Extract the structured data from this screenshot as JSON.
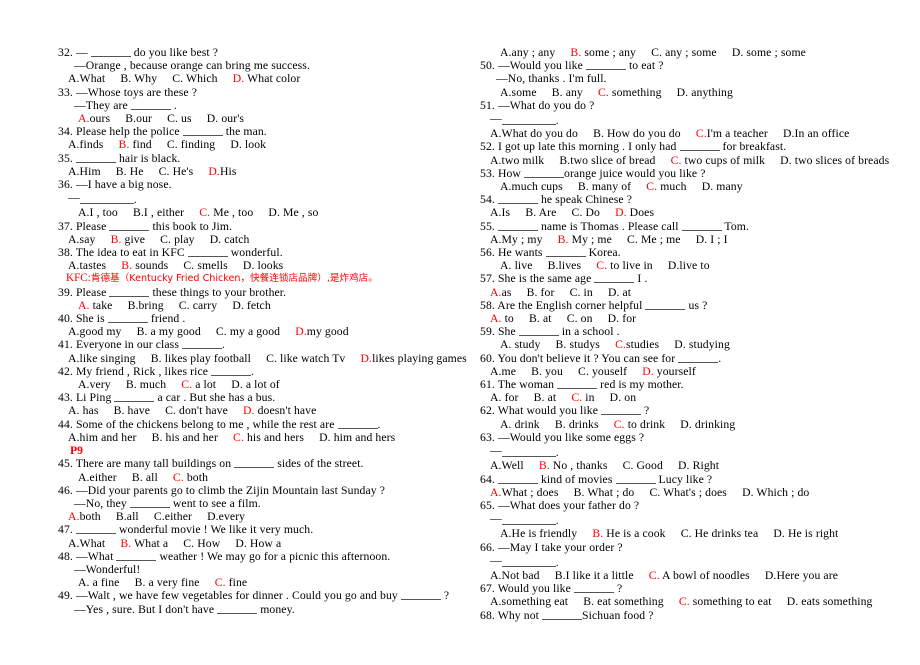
{
  "document": {
    "type": "english-grammar-multiple-choice-worksheet",
    "answer_color": "#FF0000",
    "text_color": "#000000",
    "background_color": "#FFFFFF"
  },
  "annotations": {
    "kfc_note": "KFC:肯德基（Kentucky Fried Chicken，快餐连锁店品牌）,是炸鸡店。",
    "page_marker": "P9"
  },
  "left_column": [
    {
      "number": "32.",
      "stem": "— ______ do you like best ?",
      "reply": "—Orange , because orange can bring me success.",
      "options": [
        {
          "text": "A.What",
          "correct": false
        },
        {
          "text": "B. Why",
          "correct": false
        },
        {
          "text": "C. Which",
          "correct": false
        },
        {
          "text": "D. What color",
          "correct": true
        }
      ]
    },
    {
      "number": "33.",
      "stem": "—Whose toys are these ?",
      "reply": "—They are ______ .",
      "options": [
        {
          "text": "A.ours",
          "correct": true
        },
        {
          "text": "B.our",
          "correct": false
        },
        {
          "text": "C. us",
          "correct": false
        },
        {
          "text": "D. our's",
          "correct": false
        }
      ]
    },
    {
      "number": "34.",
      "stem": "Please help the police ______ the man.",
      "options": [
        {
          "text": "A.finds",
          "correct": false
        },
        {
          "text": "B. find",
          "correct": true
        },
        {
          "text": "C. finding",
          "correct": false
        },
        {
          "text": "D. look",
          "correct": false
        }
      ]
    },
    {
      "number": "35.",
      "stem": "______ hair is black.",
      "options": [
        {
          "text": "A.Him",
          "correct": false
        },
        {
          "text": "B. He",
          "correct": false
        },
        {
          "text": "C. He's",
          "correct": false
        },
        {
          "text": "D.His",
          "correct": true
        }
      ]
    },
    {
      "number": "36.",
      "stem": "—I have a big nose.",
      "answer_blank": true,
      "options": [
        {
          "text": "A.I , too",
          "correct": false
        },
        {
          "text": "B.I , either",
          "correct": false
        },
        {
          "text": "C. Me , too",
          "correct": true
        },
        {
          "text": "D. Me , so",
          "correct": false
        }
      ]
    },
    {
      "number": "37.",
      "stem": "Please ______ this book to Jim.",
      "options": [
        {
          "text": "A.say",
          "correct": false
        },
        {
          "text": "B. give",
          "correct": true
        },
        {
          "text": "C. play",
          "correct": false
        },
        {
          "text": "D. catch",
          "correct": false
        }
      ]
    },
    {
      "number": "38.",
      "stem": "The idea to eat in KFC ______ wonderful.",
      "options": [
        {
          "text": "A.tastes",
          "correct": false
        },
        {
          "text": "B. sounds",
          "correct": true
        },
        {
          "text": "C. smells",
          "correct": false
        },
        {
          "text": "D. looks",
          "correct": false
        }
      ],
      "note": "kfc"
    },
    {
      "number": "39.",
      "stem": "Please ______ these things to your brother.",
      "options": [
        {
          "text": "A. take",
          "correct": true
        },
        {
          "text": "B.bring",
          "correct": false
        },
        {
          "text": "C. carry",
          "correct": false
        },
        {
          "text": "D. fetch",
          "correct": false
        }
      ]
    },
    {
      "number": "40.",
      "stem": "She is ______ friend .",
      "options": [
        {
          "text": "A.good my",
          "correct": false
        },
        {
          "text": "B. a my good",
          "correct": false
        },
        {
          "text": "C. my a good",
          "correct": false
        },
        {
          "text": "D.my good",
          "correct": true
        }
      ]
    },
    {
      "number": "41.",
      "stem": "Everyone in our class ______.",
      "options": [
        {
          "text": "A.like singing",
          "correct": false
        },
        {
          "text": "B. likes play football",
          "correct": false
        },
        {
          "text": "C. like watch Tv",
          "correct": false
        },
        {
          "text": "D.likes playing games",
          "correct": true
        }
      ]
    },
    {
      "number": "42.",
      "stem": "My friend , Rick , likes rice ______.",
      "options": [
        {
          "text": "A.very",
          "correct": false
        },
        {
          "text": "B. much",
          "correct": false
        },
        {
          "text": "C. a lot",
          "correct": true
        },
        {
          "text": "D. a lot of",
          "correct": false
        }
      ]
    },
    {
      "number": "43.",
      "stem": "Li Ping ______ a car . But she has a bus.",
      "options": [
        {
          "text": "A. has",
          "correct": false
        },
        {
          "text": "B. have",
          "correct": false
        },
        {
          "text": "C. don't have",
          "correct": false
        },
        {
          "text": "D. doesn't have",
          "correct": true
        }
      ]
    },
    {
      "number": "44.",
      "stem": "Some of the chickens belong to me , while the rest are ______.",
      "options": [
        {
          "text": "A.him and her",
          "correct": false
        },
        {
          "text": "B. his and her",
          "correct": false
        },
        {
          "text": "C. his and hers",
          "correct": true
        },
        {
          "text": "D. him and hers",
          "correct": false
        }
      ],
      "note": "p9"
    },
    {
      "number": "45.",
      "stem": "There are many tall buildings on ______ sides of the street.",
      "options": [
        {
          "text": "A.either",
          "correct": false
        },
        {
          "text": "B. all",
          "correct": false
        },
        {
          "text": "C. both",
          "correct": true
        }
      ]
    },
    {
      "number": "46.",
      "stem": "—Did your parents go to climb the Zijin Mountain last Sunday ?",
      "reply": "—No, they ______ went to see a film.",
      "options": [
        {
          "text": "A.both",
          "correct": true
        },
        {
          "text": "B.all",
          "correct": false
        },
        {
          "text": "C.either",
          "correct": false
        },
        {
          "text": "D.every",
          "correct": false
        }
      ]
    },
    {
      "number": "47.",
      "stem": "______ wonderful movie ! We like it very much.",
      "options": [
        {
          "text": "A.What",
          "correct": false
        },
        {
          "text": "B. What a",
          "correct": true
        },
        {
          "text": "C. How",
          "correct": false
        },
        {
          "text": "D. How a",
          "correct": false
        }
      ]
    },
    {
      "number": "48.",
      "stem": "—What ______ weather ! We may go for a picnic this afternoon.",
      "reply": "—Wonderful!",
      "options": [
        {
          "text": "A. a fine",
          "correct": false
        },
        {
          "text": "B. a very fine",
          "correct": false
        },
        {
          "text": "C. fine",
          "correct": true
        }
      ]
    },
    {
      "number": "49.",
      "stem": "—Walt , we have few vegetables for dinner . Could you go and buy ______ ?",
      "reply": "—Yes , sure. But I don't have ______ money."
    }
  ],
  "right_column": [
    {
      "number": "",
      "options_only": true,
      "options": [
        {
          "text": "A.any ; any",
          "correct": false
        },
        {
          "text": "B. some ; any",
          "correct": true
        },
        {
          "text": "C. any ; some",
          "correct": false
        },
        {
          "text": "D. some ; some",
          "correct": false
        }
      ]
    },
    {
      "number": "50.",
      "stem": "—Would you like ______ to eat ?",
      "reply": "—No, thanks . I'm full.",
      "options": [
        {
          "text": "A.some",
          "correct": false
        },
        {
          "text": "B. any",
          "correct": false
        },
        {
          "text": "C. something",
          "correct": true
        },
        {
          "text": "D. anything",
          "correct": false
        }
      ]
    },
    {
      "number": "51.",
      "stem": "—What do you do ?",
      "answer_blank": true,
      "options": [
        {
          "text": "A.What do you do",
          "correct": false
        },
        {
          "text": "B. How do you do",
          "correct": false
        },
        {
          "text": "C.I'm a teacher",
          "correct": true
        },
        {
          "text": "D.In an office",
          "correct": false
        }
      ]
    },
    {
      "number": "52.",
      "stem": "I got up late this morning . I only had ______ for breakfast.",
      "options": [
        {
          "text": "A.two milk",
          "correct": false
        },
        {
          "text": "B.two slice of bread",
          "correct": false
        },
        {
          "text": "C. two cups of milk",
          "correct": true
        },
        {
          "text": "D. two slices of breads",
          "correct": false
        }
      ]
    },
    {
      "number": "53.",
      "stem": "How ______orange juice would you like ?",
      "options": [
        {
          "text": "A.much cups",
          "correct": false
        },
        {
          "text": "B. many of",
          "correct": false
        },
        {
          "text": "C. much",
          "correct": true
        },
        {
          "text": "D. many",
          "correct": false
        }
      ]
    },
    {
      "number": "54.",
      "stem": "______ he speak Chinese ?",
      "options": [
        {
          "text": "A.Is",
          "correct": false
        },
        {
          "text": "B. Are",
          "correct": false
        },
        {
          "text": "C. Do",
          "correct": false
        },
        {
          "text": "D. Does",
          "correct": true
        }
      ]
    },
    {
      "number": "55.",
      "stem": "______ name is Thomas . Please call ______ Tom.",
      "options": [
        {
          "text": "A.My ; my",
          "correct": false
        },
        {
          "text": "B. My ; me",
          "correct": true
        },
        {
          "text": "C. Me ; me",
          "correct": false
        },
        {
          "text": "D. I ; I",
          "correct": false
        }
      ]
    },
    {
      "number": "56.",
      "stem": "He wants ______ Korea.",
      "options": [
        {
          "text": "A. live",
          "correct": false
        },
        {
          "text": "B.lives",
          "correct": false
        },
        {
          "text": "C. to live in",
          "correct": true
        },
        {
          "text": "D.live to",
          "correct": false
        }
      ]
    },
    {
      "number": "57.",
      "stem": "She is the same age ______ I .",
      "options": [
        {
          "text": "A.as",
          "correct": true
        },
        {
          "text": "B. for",
          "correct": false
        },
        {
          "text": "C. in",
          "correct": false
        },
        {
          "text": "D. at",
          "correct": false
        }
      ]
    },
    {
      "number": "58.",
      "stem": "Are the English corner helpful ______ us ?",
      "options": [
        {
          "text": "A. to",
          "correct": true
        },
        {
          "text": "B. at",
          "correct": false
        },
        {
          "text": "C. on",
          "correct": false
        },
        {
          "text": "D. for",
          "correct": false
        }
      ]
    },
    {
      "number": "59.",
      "stem": "She ______ in a school .",
      "options": [
        {
          "text": "A. study",
          "correct": false
        },
        {
          "text": "B. studys",
          "correct": false
        },
        {
          "text": "C.studies",
          "correct": true
        },
        {
          "text": "D. studying",
          "correct": false
        }
      ]
    },
    {
      "number": "60.",
      "stem": "You don't believe it ? You can see for ______.",
      "options": [
        {
          "text": "A.me",
          "correct": false
        },
        {
          "text": "B. you",
          "correct": false
        },
        {
          "text": "C. youself",
          "correct": false
        },
        {
          "text": "D. yourself",
          "correct": true
        }
      ]
    },
    {
      "number": "61.",
      "stem": "The woman ______ red is my mother.",
      "options": [
        {
          "text": "A. for",
          "correct": false
        },
        {
          "text": "B. at",
          "correct": false
        },
        {
          "text": "C. in",
          "correct": true
        },
        {
          "text": "D. on",
          "correct": false
        }
      ]
    },
    {
      "number": "62.",
      "stem": "What would you like ______ ?",
      "options": [
        {
          "text": "A. drink",
          "correct": false
        },
        {
          "text": "B. drinks",
          "correct": false
        },
        {
          "text": "C. to drink",
          "correct": true
        },
        {
          "text": "D. drinking",
          "correct": false
        }
      ]
    },
    {
      "number": "63.",
      "stem": "—Would you like some eggs ?",
      "answer_blank": true,
      "options": [
        {
          "text": "A.Well",
          "correct": false
        },
        {
          "text": "B. No , thanks",
          "correct": true
        },
        {
          "text": "C. Good",
          "correct": false
        },
        {
          "text": "D. Right",
          "correct": false
        }
      ]
    },
    {
      "number": "64.",
      "stem": "______ kind of movies ______ Lucy like ?",
      "options": [
        {
          "text": "A.What ; does",
          "correct": true
        },
        {
          "text": "B. What ; do",
          "correct": false
        },
        {
          "text": "C. What's ; does",
          "correct": false
        },
        {
          "text": "D. Which ; do",
          "correct": false
        }
      ]
    },
    {
      "number": "65.",
      "stem": "—What does your father do ?",
      "answer_blank": true,
      "options": [
        {
          "text": "A.He is friendly",
          "correct": false
        },
        {
          "text": "B. He is a cook",
          "correct": true
        },
        {
          "text": "C. He drinks tea",
          "correct": false
        },
        {
          "text": "D. He is right",
          "correct": false
        }
      ]
    },
    {
      "number": "66.",
      "stem": "—May I take your order ?",
      "answer_blank": true,
      "options": [
        {
          "text": "A.Not bad",
          "correct": false
        },
        {
          "text": "B.I like it a little",
          "correct": false
        },
        {
          "text": "C. A bowl of noodles",
          "correct": true
        },
        {
          "text": "D.Here you are",
          "correct": false
        }
      ]
    },
    {
      "number": "67.",
      "stem": "Would you like ______ ?",
      "options": [
        {
          "text": "A.something eat",
          "correct": false
        },
        {
          "text": "B. eat something",
          "correct": false
        },
        {
          "text": "C. something to eat",
          "correct": true
        },
        {
          "text": "D. eats something",
          "correct": false
        }
      ]
    },
    {
      "number": "68.",
      "stem": "Why not ______Sichuan food ?"
    }
  ]
}
